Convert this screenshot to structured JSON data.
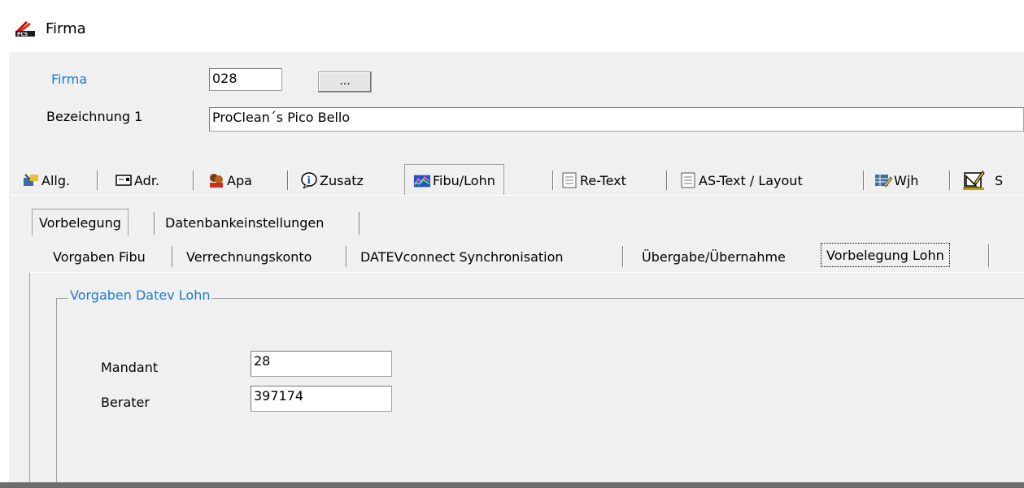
{
  "window": {
    "title": "Firma",
    "icon": "pcs-app-icon"
  },
  "header": {
    "firma_label": "Firma",
    "firma_value": "028",
    "browse_button": "...",
    "bezeichnung_label": "Bezeichnung 1",
    "bezeichnung_value": "ProClean´s Pico Bello"
  },
  "main_tabs": [
    {
      "label": "Allg.",
      "icon": "settings-tools-icon"
    },
    {
      "label": "Adr.",
      "icon": "address-card-icon"
    },
    {
      "label": "Apa",
      "icon": "contacts-icon"
    },
    {
      "label": "Zusatz",
      "icon": "info-icon"
    },
    {
      "label": "Fibu/Lohn",
      "icon": "chart-icon",
      "active": true
    },
    {
      "label": "Re-Text",
      "icon": "document-icon"
    },
    {
      "label": "AS-Text / Layout",
      "icon": "document-icon"
    },
    {
      "label": "Wjh",
      "icon": "edit-grid-icon"
    },
    {
      "label": "S",
      "icon": "drafting-icon"
    }
  ],
  "sub_tabs_level1": [
    {
      "label": "Vorbelegung",
      "active": true
    },
    {
      "label": "Datenbankeinstellungen"
    }
  ],
  "sub_tabs_level2": [
    {
      "label": "Vorgaben Fibu"
    },
    {
      "label": "Verrechnungskonto"
    },
    {
      "label": "DATEVconnect Synchronisation"
    },
    {
      "label": "Übergabe/Übernahme"
    },
    {
      "label": "Vorbelegung Lohn",
      "active": true
    }
  ],
  "group": {
    "title": "Vorgaben Datev Lohn",
    "mandant_label": "Mandant",
    "mandant_value": "28",
    "berater_label": "Berater",
    "berater_value": "397174"
  },
  "colors": {
    "accent_blue": "#1e7bd8",
    "panel_bg": "#f0f0f0"
  }
}
